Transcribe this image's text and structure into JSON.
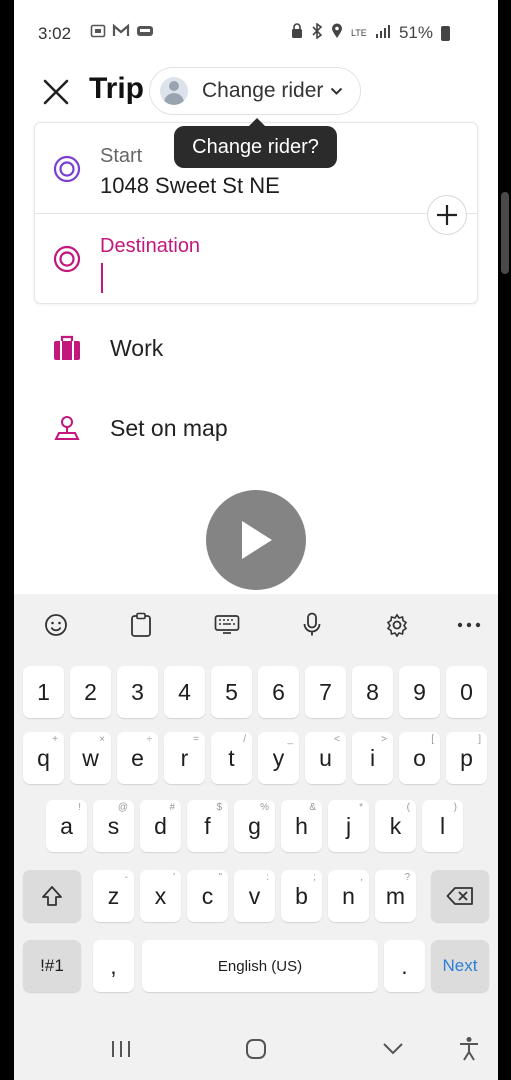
{
  "status_bar": {
    "time": "3:02",
    "notification_icons": [
      "screenshot-icon",
      "gmail-icon",
      "taxi-app-icon"
    ],
    "system_icons": [
      "lock-icon",
      "bluetooth-icon",
      "location-icon",
      "lte-icon",
      "signal-icon"
    ],
    "network": "LTE",
    "battery": "51%"
  },
  "header": {
    "title": "Trip",
    "rider_chip_label": "Change rider",
    "tooltip": "Change rider?"
  },
  "route": {
    "start_label": "Start",
    "start_value": "1048 Sweet St NE",
    "destination_label": "Destination",
    "destination_value": ""
  },
  "shortcuts": [
    {
      "label": "Work",
      "icon": "briefcase-icon"
    },
    {
      "label": "Set on map",
      "icon": "map-pin-icon"
    }
  ],
  "colors": {
    "accent": "#c2177c",
    "keyboard_bg": "#f1f1f1",
    "next_key": "#2d7fd8"
  },
  "keyboard": {
    "toolbar": [
      "emoji-icon",
      "clipboard-icon",
      "keyboard-icon",
      "microphone-icon",
      "settings-icon",
      "more-icon"
    ],
    "row_numbers": [
      "1",
      "2",
      "3",
      "4",
      "5",
      "6",
      "7",
      "8",
      "9",
      "0"
    ],
    "row1": [
      "q",
      "w",
      "e",
      "r",
      "t",
      "y",
      "u",
      "i",
      "o",
      "p"
    ],
    "row1_hints": [
      "+",
      "×",
      "÷",
      "=",
      "/",
      "_",
      "<",
      ">",
      "[",
      "]"
    ],
    "row2": [
      "a",
      "s",
      "d",
      "f",
      "g",
      "h",
      "j",
      "k",
      "l"
    ],
    "row2_hints": [
      "!",
      "@",
      "#",
      "$",
      "%",
      "&",
      "*",
      "(",
      ")"
    ],
    "row3": [
      "z",
      "x",
      "c",
      "v",
      "b",
      "n",
      "m"
    ],
    "row3_hints": [
      "-",
      "'",
      "\"",
      ":",
      ";",
      ",",
      "?"
    ],
    "symbols_key": "!#1",
    "comma_key": ",",
    "space_label": "English (US)",
    "period_key": ".",
    "next_key": "Next"
  },
  "nav_bar": [
    "recent-apps-icon",
    "home-icon",
    "back-icon",
    "accessibility-icon"
  ]
}
